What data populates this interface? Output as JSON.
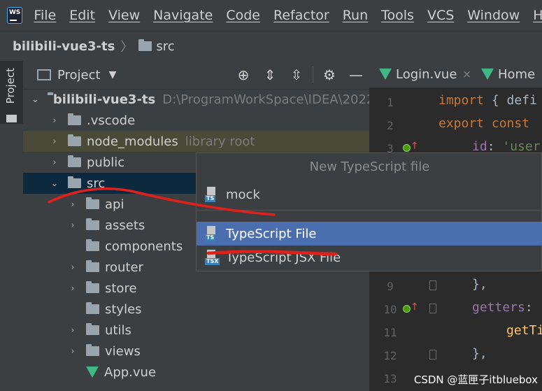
{
  "menubar": {
    "logo": "WS",
    "items": [
      "File",
      "Edit",
      "View",
      "Navigate",
      "Code",
      "Refactor",
      "Run",
      "Tools",
      "VCS",
      "Window",
      "Help"
    ]
  },
  "navbar": {
    "project": "bilibili-vue3-ts",
    "folder": "src"
  },
  "left_strip": {
    "label": "Project"
  },
  "project_panel": {
    "title": "Project",
    "tree": [
      {
        "label": "bilibili-vue3-ts",
        "hint": "D:\\ProgramWorkSpace\\IDEA\\2022"
      },
      {
        "label": ".vscode"
      },
      {
        "label": "node_modules",
        "hint": "library root"
      },
      {
        "label": "public"
      },
      {
        "label": "src"
      },
      {
        "label": "api"
      },
      {
        "label": "assets"
      },
      {
        "label": "components"
      },
      {
        "label": "router"
      },
      {
        "label": "store"
      },
      {
        "label": "styles"
      },
      {
        "label": "utils"
      },
      {
        "label": "views"
      },
      {
        "label": "App.vue"
      }
    ]
  },
  "editor": {
    "tabs": [
      {
        "label": "Login.vue",
        "close": "×"
      },
      {
        "label": "Home"
      }
    ],
    "line_numbers": [
      "1",
      "2",
      "3",
      "9",
      "10",
      "11",
      "12",
      "13"
    ],
    "code": {
      "l1_kw": "import",
      "l1_rest": " { defi",
      "l2_kw": "export",
      "l2_rest": " const",
      "l3_prop": "id",
      "l3_punc": ": ",
      "l3_str": "'user",
      "l9": "},",
      "l10_prop": "getters",
      "l10_punc": ":",
      "l11_fn": "getTi",
      "l12": "},"
    }
  },
  "popup": {
    "title": "New TypeScript file",
    "items": [
      {
        "label": "mock",
        "icon_text": "TS"
      },
      {
        "label": "TypeScript File",
        "icon_text": "TS"
      },
      {
        "label": "TypeScript JSX File",
        "icon_text": "TSX"
      }
    ]
  },
  "watermark": "CSDN @蓝匣子itbluebox",
  "colors": {
    "accent_selected": "#4b6eaf",
    "annotation": "#e0201b",
    "vue_green": "#41b883"
  }
}
